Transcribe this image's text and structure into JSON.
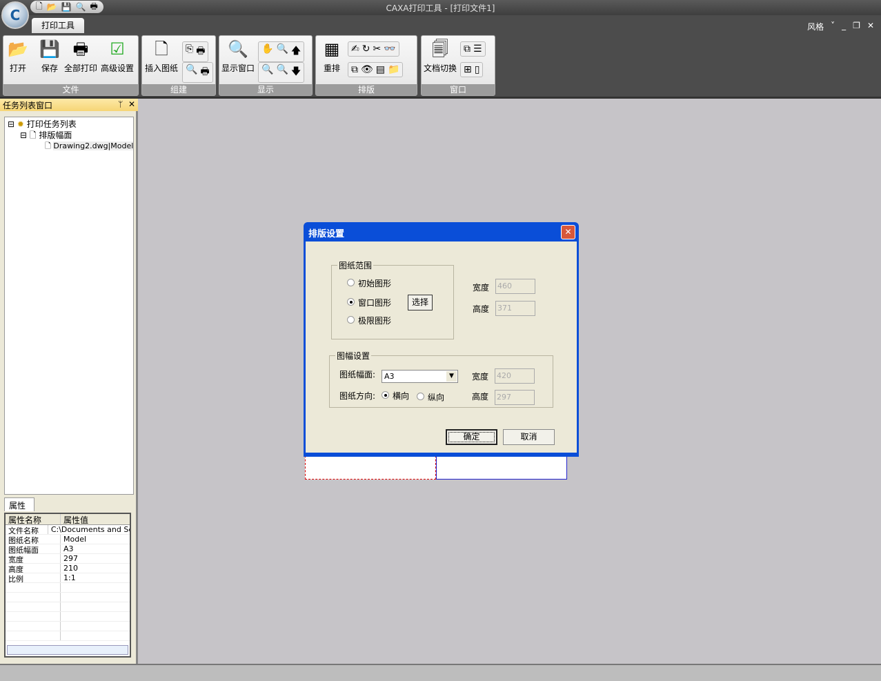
{
  "app": {
    "title": "CAXA打印工具 - [打印文件1]",
    "tab": "打印工具",
    "style_menu": "风格"
  },
  "quick_access": [
    "new-icon",
    "open-icon",
    "save-icon",
    "preview-icon",
    "print-icon"
  ],
  "ribbon": {
    "file": {
      "label": "文件",
      "buttons": [
        "打开",
        "保存",
        "全部打印",
        "高级设置"
      ]
    },
    "build": {
      "label": "组建",
      "buttons": [
        "插入图纸"
      ]
    },
    "display": {
      "label": "显示",
      "buttons": [
        "显示窗口"
      ]
    },
    "layout": {
      "label": "排版",
      "buttons": [
        "重排"
      ]
    },
    "window": {
      "label": "窗口",
      "buttons": [
        "文档切换"
      ]
    }
  },
  "task_panel": {
    "title": "任务列表窗口",
    "tree": [
      "打印任务列表",
      "排版幅面",
      "Drawing2.dwg|Model"
    ]
  },
  "properties": {
    "tab": "属性",
    "headers": [
      "属性名称",
      "属性值"
    ],
    "rows": [
      [
        "文件名称",
        "C:\\Documents and Settings"
      ],
      [
        "图纸名称",
        "Model"
      ],
      [
        "图纸幅面",
        "A3"
      ],
      [
        "宽度",
        "297"
      ],
      [
        "高度",
        "210"
      ],
      [
        "比例",
        "1:1"
      ]
    ]
  },
  "dialog": {
    "title": "排版设置",
    "range_group": "图纸范围",
    "range_options": [
      "初始图形",
      "窗口图形",
      "极限图形"
    ],
    "range_selected": "窗口图形",
    "select_button": "选择",
    "width_label": "宽度",
    "height_label": "高度",
    "range_width": "460",
    "range_height": "371",
    "sheet_group": "图幅设置",
    "sheet_size_label": "图纸幅面:",
    "sheet_size": "A3",
    "orientation_label": "图纸方向:",
    "orientations": [
      "横向",
      "纵向"
    ],
    "orientation_selected": "横向",
    "sheet_width": "420",
    "sheet_height": "297",
    "ok": "确定",
    "cancel": "取消"
  }
}
